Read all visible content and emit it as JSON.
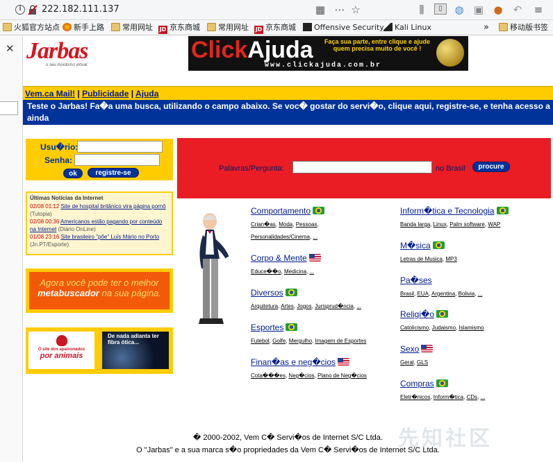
{
  "browser": {
    "url": "222.182.111.137",
    "bookmarks": [
      {
        "label": "火狐官方站点",
        "icon": "folder-icon"
      },
      {
        "label": "新手上路",
        "icon": "firefox-icon"
      },
      {
        "label": "常用网址",
        "icon": "folder-icon"
      },
      {
        "label": "京东商城",
        "icon": "jd-icon"
      },
      {
        "label": "常用网址",
        "icon": "folder-icon"
      },
      {
        "label": "京东商城",
        "icon": "jd-icon"
      },
      {
        "label": "Offensive Security",
        "icon": "offsec-icon"
      },
      {
        "label": "Kali Linux",
        "icon": "kali-icon"
      }
    ],
    "mobile_bookmarks": "移动版书签",
    "jd_icon_text": "JD"
  },
  "header": {
    "logo_text": "Jarbas",
    "logo_tagline": "o seu mordomo virtual",
    "banner": {
      "click": "Click",
      "ajuda": "Ajuda",
      "slogan": "Faça sua parte, entre clique e ajude quem precisa muito de você !",
      "site": "www.clickajuda.com.br"
    }
  },
  "nav": {
    "mail": "Vem.ca Mail!",
    "sep": " | ",
    "publicidade": "Publicidade",
    "ajuda": "Ajuda"
  },
  "promo": {
    "line1": "Teste o Jarbas! Fa�a uma busca, utilizando o campo abaixo. Se voc� gostar do servi�o, clique aqui, registre-se, e tenha acesso a ainda",
    "line2": "mais facilidades!"
  },
  "login": {
    "user_label": "Usu�rio:",
    "pass_label": "Senha:",
    "ok": "ok",
    "register": "registre-se"
  },
  "news": {
    "title": "Últimas Notícias da Internet",
    "items": [
      {
        "time": "02/08 01:12",
        "headline": "Site de hospital britânico vira página pornô",
        "source": "(Tutopia)"
      },
      {
        "time": "02/08 00:36",
        "headline": "Americanos estão pagando por conteúdo na Internet",
        "source": "(Diário OnLine)"
      },
      {
        "time": "01/08 23:16",
        "headline": "Site brasileiro \"põe\" Luís Mário no Porto",
        "source": "(Jn.PT/Esporte)"
      }
    ]
  },
  "ads": {
    "meta_line1": "Agora você pode ter o melhor",
    "meta_bold": "metabuscador",
    "meta_rest": " na sua página.",
    "animals_small": "O site dos apaixonados",
    "animals_big": "por animais",
    "fiber": "De nada adianta ter fibra ótica..."
  },
  "search": {
    "label": "Palavras/Pergunta:",
    "scope": "no Brasil",
    "button": "procure"
  },
  "categories": {
    "left": [
      {
        "title": "Comportamento",
        "flag": "br",
        "subs": [
          "Crian�as",
          "Moda",
          "Pessoas",
          "Personalidades/Cinema",
          "..."
        ]
      },
      {
        "title": "Corpo & Mente",
        "flag": "us",
        "subs": [
          "Educe��o",
          "Medicina",
          "..."
        ]
      },
      {
        "title": "Diversos",
        "flag": "br",
        "subs": [
          "Arquitetura",
          "Artes",
          "Jogos",
          "Jurisprud�ncia",
          "..."
        ]
      },
      {
        "title": "Esportes",
        "flag": "br",
        "subs": [
          "Futebol",
          "Golfe",
          "Mergulho",
          "Imagem de Esportes"
        ]
      },
      {
        "title": "Finan�as e neg�cios",
        "flag": "us",
        "subs": [
          "Cota���es",
          "Neg�cios",
          "Plano de Neg�cios"
        ]
      }
    ],
    "right": [
      {
        "title": "Inform�tica e Tecnologia",
        "flag": "br",
        "subs": [
          "Banda larga",
          "Linux",
          "Palm software",
          "WAP"
        ]
      },
      {
        "title": "M�sica",
        "flag": "br",
        "subs": [
          "Letras de Musica",
          "MP3"
        ]
      },
      {
        "title": "Pa�ses",
        "flag": "",
        "subs": [
          "Brasil",
          "EUA",
          "Argentina",
          "Bolivia",
          "..."
        ]
      },
      {
        "title": "Religi�o",
        "flag": "br",
        "subs": [
          "Catolicismo",
          "Judaismo",
          "Islamismo"
        ]
      },
      {
        "title": "Sexo",
        "flag": "us",
        "subs": [
          "Geral",
          "GLS"
        ]
      },
      {
        "title": "Compras",
        "flag": "br",
        "subs": [
          "Eletr�nicos",
          "Inform�tica",
          "CDs",
          "..."
        ]
      }
    ]
  },
  "footer": {
    "line1": "� 2000-2002, Vem C� Servi�os de Internet S/C Ltda.",
    "line2": "O \"Jarbas\" e a sua marca s�o propriedades da Vem C� Servi�os de Internet S/C Ltda."
  },
  "watermark": "先知社区",
  "colors": {
    "brand_red": "#ea1c24",
    "brand_yellow": "#ffcc00",
    "brand_blue": "#00339a"
  }
}
